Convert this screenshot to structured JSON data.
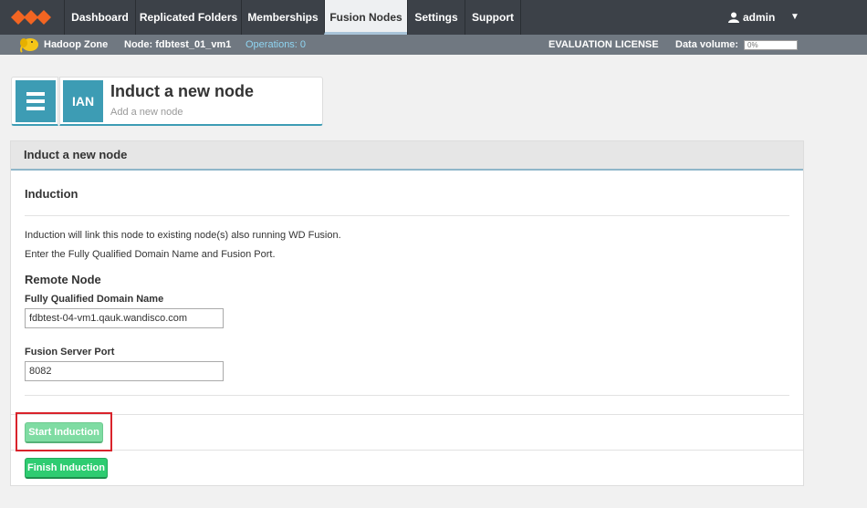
{
  "nav": {
    "tabs": [
      {
        "label": "Dashboard"
      },
      {
        "label": "Replicated Folders"
      },
      {
        "label": "Memberships"
      },
      {
        "label": "Fusion Nodes"
      },
      {
        "label": "Settings"
      },
      {
        "label": "Support"
      }
    ],
    "active_tab": "Fusion Nodes",
    "user": "admin",
    "user_icon": "user-icon",
    "menu_icon": "caret-down-icon"
  },
  "status_bar": {
    "zone": "Hadoop Zone",
    "node": "Node: fdbtest_01_vm1",
    "operations": "Operations: 0",
    "license": "EVALUATION LICENSE",
    "data_volume_label": "Data volume:",
    "data_volume_value": "0%"
  },
  "header": {
    "badge": "IAN",
    "title": "Induct a new node",
    "subtitle": "Add a new node"
  },
  "panel": {
    "title": "Induct a new node",
    "section_title": "Induction",
    "line1": "Induction will link this node to existing node(s) also running WD Fusion.",
    "line2": "Enter the Fully Qualified Domain Name and Fusion Port.",
    "remote_title": "Remote Node",
    "fqdn_label": "Fully Qualified Domain Name",
    "fqdn_value": "fdbtest-04-vm1.qauk.wandisco.com",
    "port_label": "Fusion Server Port",
    "port_value": "8082",
    "start_button": "Start Induction",
    "finish_button": "Finish Induction"
  },
  "colors": {
    "nav_bg": "#3c4148",
    "accent": "#3d9cb4",
    "logo": "#f26522",
    "button": "#2ecc71",
    "highlight": "#d9232b"
  }
}
